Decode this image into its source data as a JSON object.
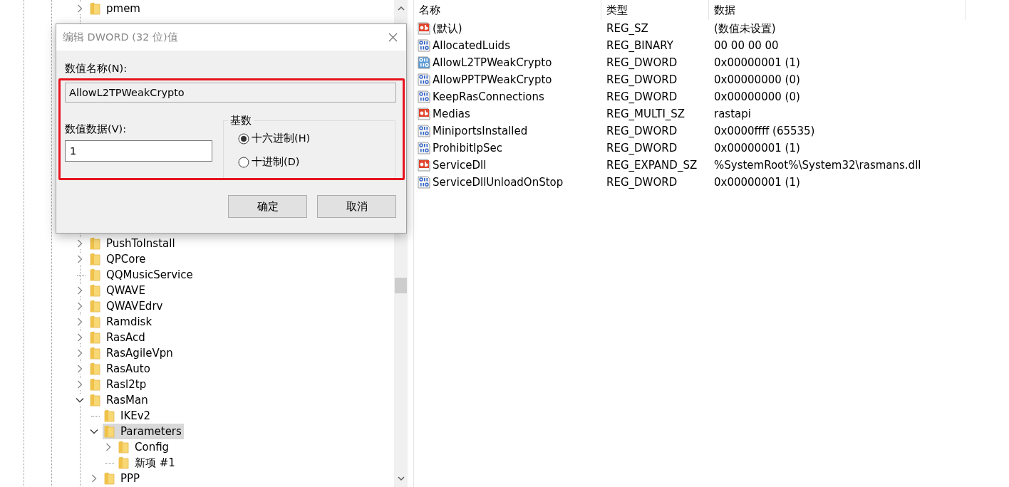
{
  "tree": {
    "items": [
      {
        "label": "pmem",
        "kind": "branch",
        "expanded": false,
        "selected": false
      },
      {
        "label": "PushToInstall",
        "kind": "branch",
        "expanded": false,
        "selected": false
      },
      {
        "label": "QPCore",
        "kind": "branch",
        "expanded": false,
        "selected": false
      },
      {
        "label": "QQMusicService",
        "kind": "leaf",
        "selected": false
      },
      {
        "label": "QWAVE",
        "kind": "branch",
        "expanded": false,
        "selected": false
      },
      {
        "label": "QWAVEdrv",
        "kind": "branch",
        "expanded": false,
        "selected": false
      },
      {
        "label": "Ramdisk",
        "kind": "branch",
        "expanded": false,
        "selected": false
      },
      {
        "label": "RasAcd",
        "kind": "branch",
        "expanded": false,
        "selected": false
      },
      {
        "label": "RasAgileVpn",
        "kind": "branch",
        "expanded": false,
        "selected": false
      },
      {
        "label": "RasAuto",
        "kind": "branch",
        "expanded": false,
        "selected": false
      },
      {
        "label": "Rasl2tp",
        "kind": "branch",
        "expanded": false,
        "selected": false
      },
      {
        "label": "RasMan",
        "kind": "branch",
        "expanded": true,
        "selected": false,
        "children": [
          {
            "label": "IKEv2",
            "kind": "leaf",
            "selected": false
          },
          {
            "label": "Parameters",
            "kind": "branch",
            "expanded": true,
            "selected": true,
            "children": [
              {
                "label": "Config",
                "kind": "branch",
                "expanded": false,
                "selected": false
              },
              {
                "label": "新项 #1",
                "kind": "leaf",
                "selected": false
              }
            ]
          },
          {
            "label": "PPP",
            "kind": "branch",
            "expanded": false,
            "selected": false
          }
        ]
      }
    ]
  },
  "values": {
    "columns": [
      "名称",
      "类型",
      "数据"
    ],
    "rows": [
      {
        "name": "(默认)",
        "type": "REG_SZ",
        "data": "(数值未设置)",
        "kind": "string",
        "selected": false
      },
      {
        "name": "AllocatedLuids",
        "type": "REG_BINARY",
        "data": "00 00 00 00",
        "kind": "binary",
        "selected": false
      },
      {
        "name": "AllowL2TPWeakCrypto",
        "type": "REG_DWORD",
        "data": "0x00000001 (1)",
        "kind": "binary",
        "selected": true
      },
      {
        "name": "AllowPPTPWeakCrypto",
        "type": "REG_DWORD",
        "data": "0x00000000 (0)",
        "kind": "binary",
        "selected": false
      },
      {
        "name": "KeepRasConnections",
        "type": "REG_DWORD",
        "data": "0x00000000 (0)",
        "kind": "binary",
        "selected": false
      },
      {
        "name": "Medias",
        "type": "REG_MULTI_SZ",
        "data": "rastapi",
        "kind": "string",
        "selected": false
      },
      {
        "name": "MiniportsInstalled",
        "type": "REG_DWORD",
        "data": "0x0000ffff (65535)",
        "kind": "binary",
        "selected": false
      },
      {
        "name": "ProhibitIpSec",
        "type": "REG_DWORD",
        "data": "0x00000001 (1)",
        "kind": "binary",
        "selected": false
      },
      {
        "name": "ServiceDll",
        "type": "REG_EXPAND_SZ",
        "data": "%SystemRoot%\\System32\\rasmans.dll",
        "kind": "string",
        "selected": false
      },
      {
        "name": "ServiceDllUnloadOnStop",
        "type": "REG_DWORD",
        "data": "0x00000001 (1)",
        "kind": "binary",
        "selected": false
      }
    ]
  },
  "dialog": {
    "title": "编辑 DWORD (32 位)值",
    "name_label": "数值名称(N):",
    "name_value": "AllowL2TPWeakCrypto",
    "data_label": "数值数据(V):",
    "data_value": "1",
    "base_group": "基数",
    "bases": [
      {
        "label": "十六进制(H)",
        "selected": true
      },
      {
        "label": "十进制(D)",
        "selected": false
      }
    ],
    "buttons": [
      "确定",
      "取消"
    ],
    "highlighted": true
  }
}
